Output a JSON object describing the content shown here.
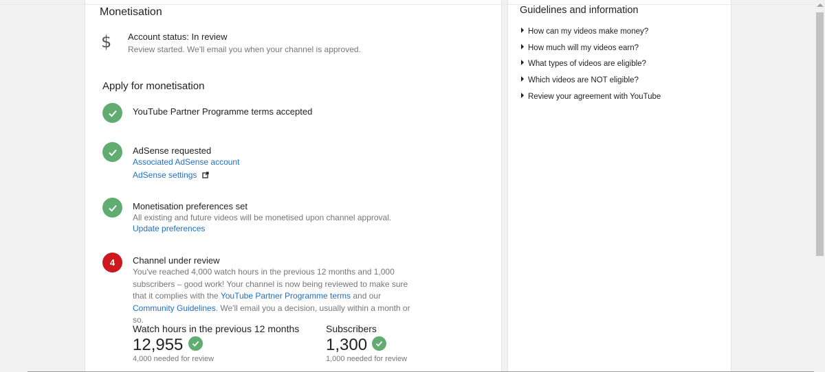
{
  "monetisation": {
    "title": "Monetisation",
    "dollar_glyph": "$",
    "account_status": "Account status: In review",
    "account_note": "Review started. We'll email you when your channel is approved."
  },
  "apply": {
    "title": "Apply for monetisation",
    "step1": {
      "title": "YouTube Partner Programme terms accepted"
    },
    "step2": {
      "title": "AdSense requested",
      "link1": "Associated AdSense account",
      "link2": "AdSense settings"
    },
    "step3": {
      "title": "Monetisation preferences set",
      "desc": "All existing and future videos will be monetised upon channel approval.",
      "link": "Update preferences"
    },
    "step4": {
      "number": "4",
      "title": "Channel under review",
      "desc_part1": "You've reached 4,000 watch hours in the previous 12 months and 1,000 subscribers – good work! Your channel is now being reviewed to make sure that it complies with the ",
      "link1": "YouTube Partner Programme terms",
      "desc_part2": " and our ",
      "link2": "Community Guidelines",
      "desc_part3": ". We'll email you a decision, usually within a month or so."
    }
  },
  "stats": {
    "watch": {
      "label": "Watch hours in the previous 12 months",
      "value": "12,955",
      "note": "4,000 needed for review"
    },
    "subs": {
      "label": "Subscribers",
      "value": "1,300",
      "note": "1,000 needed for review"
    }
  },
  "guidelines": {
    "title": "Guidelines and information",
    "items": [
      "How can my videos make money?",
      "How much will my videos earn?",
      "What types of videos are eligible?",
      "Which videos are NOT eligible?",
      "Review your agreement with YouTube"
    ]
  },
  "colors": {
    "success": "#61ac71",
    "alert": "#cc181e",
    "link": "#1f6fc4"
  }
}
